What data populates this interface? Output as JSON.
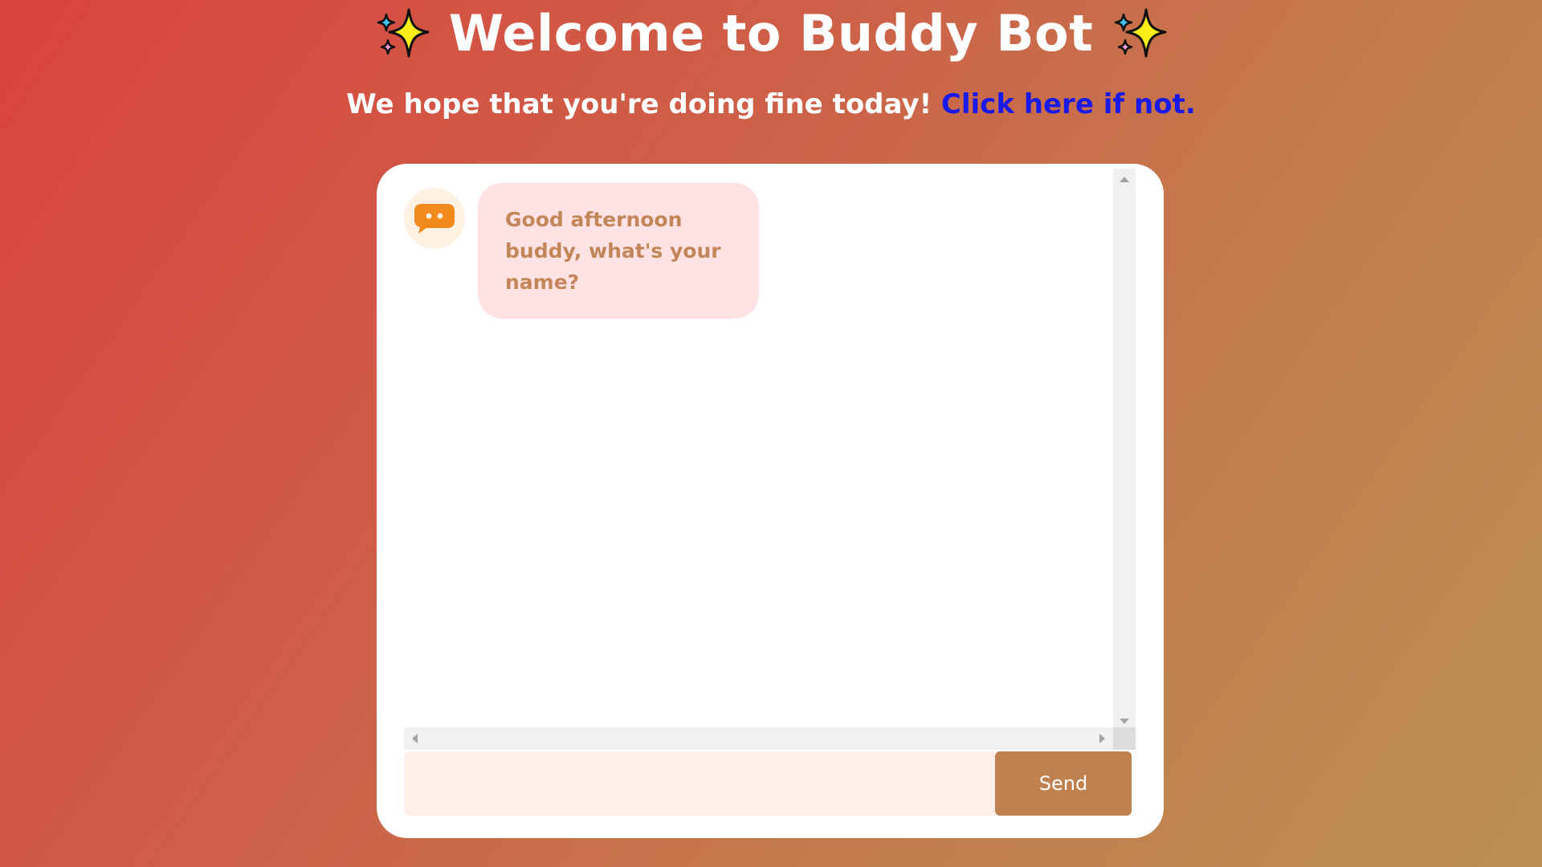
{
  "header": {
    "title": "Welcome to Buddy Bot",
    "subtitle": "We hope that you're doing fine today!",
    "help_link": "Click here if not.",
    "title_icon": "sparkles-icon"
  },
  "chat": {
    "messages": [
      {
        "sender": "bot",
        "avatar_icon": "chat-bubble-icon",
        "text": "Good afternoon buddy, what's your name?"
      }
    ]
  },
  "composer": {
    "input_value": "",
    "input_placeholder": "",
    "send_label": "Send"
  },
  "colors": {
    "accent": "#bf8150",
    "bubble_bg": "#ffe3e4",
    "bubble_text": "#c28658",
    "link": "#1a1ae8",
    "input_bg": "#fff0e7"
  }
}
